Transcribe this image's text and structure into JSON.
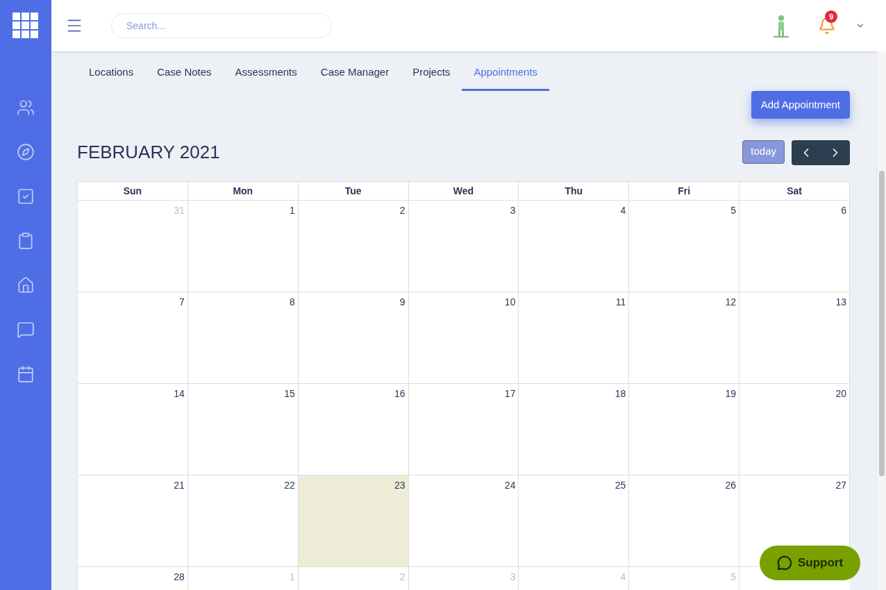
{
  "search": {
    "placeholder": "Search..."
  },
  "notifications": {
    "count": "9"
  },
  "tabs": [
    {
      "label": "Locations",
      "selected": false
    },
    {
      "label": "Case Notes",
      "selected": false
    },
    {
      "label": "Assessments",
      "selected": false
    },
    {
      "label": "Case Manager",
      "selected": false
    },
    {
      "label": "Projects",
      "selected": false
    },
    {
      "label": "Appointments",
      "selected": true
    }
  ],
  "add_button": "Add Appointment",
  "calendar": {
    "title": "FEBRUARY 2021",
    "today_button": {
      "label": "today",
      "disabled": true
    },
    "weekdays": [
      "Sun",
      "Mon",
      "Tue",
      "Wed",
      "Thu",
      "Fri",
      "Sat"
    ],
    "weeks": [
      [
        {
          "day": "31",
          "outside": true,
          "today": false
        },
        {
          "day": "1",
          "outside": false,
          "today": false
        },
        {
          "day": "2",
          "outside": false,
          "today": false
        },
        {
          "day": "3",
          "outside": false,
          "today": false
        },
        {
          "day": "4",
          "outside": false,
          "today": false
        },
        {
          "day": "5",
          "outside": false,
          "today": false
        },
        {
          "day": "6",
          "outside": false,
          "today": false
        }
      ],
      [
        {
          "day": "7",
          "outside": false,
          "today": false
        },
        {
          "day": "8",
          "outside": false,
          "today": false
        },
        {
          "day": "9",
          "outside": false,
          "today": false
        },
        {
          "day": "10",
          "outside": false,
          "today": false
        },
        {
          "day": "11",
          "outside": false,
          "today": false
        },
        {
          "day": "12",
          "outside": false,
          "today": false
        },
        {
          "day": "13",
          "outside": false,
          "today": false
        }
      ],
      [
        {
          "day": "14",
          "outside": false,
          "today": false
        },
        {
          "day": "15",
          "outside": false,
          "today": false
        },
        {
          "day": "16",
          "outside": false,
          "today": false
        },
        {
          "day": "17",
          "outside": false,
          "today": false
        },
        {
          "day": "18",
          "outside": false,
          "today": false
        },
        {
          "day": "19",
          "outside": false,
          "today": false
        },
        {
          "day": "20",
          "outside": false,
          "today": false
        }
      ],
      [
        {
          "day": "21",
          "outside": false,
          "today": false
        },
        {
          "day": "22",
          "outside": false,
          "today": false
        },
        {
          "day": "23",
          "outside": false,
          "today": true
        },
        {
          "day": "24",
          "outside": false,
          "today": false
        },
        {
          "day": "25",
          "outside": false,
          "today": false
        },
        {
          "day": "26",
          "outside": false,
          "today": false
        },
        {
          "day": "27",
          "outside": false,
          "today": false
        }
      ],
      [
        {
          "day": "28",
          "outside": false,
          "today": false
        },
        {
          "day": "1",
          "outside": true,
          "today": false
        },
        {
          "day": "2",
          "outside": true,
          "today": false
        },
        {
          "day": "3",
          "outside": true,
          "today": false
        },
        {
          "day": "4",
          "outside": true,
          "today": false
        },
        {
          "day": "5",
          "outside": true,
          "today": false
        }
      ]
    ]
  },
  "support_button": "Support"
}
